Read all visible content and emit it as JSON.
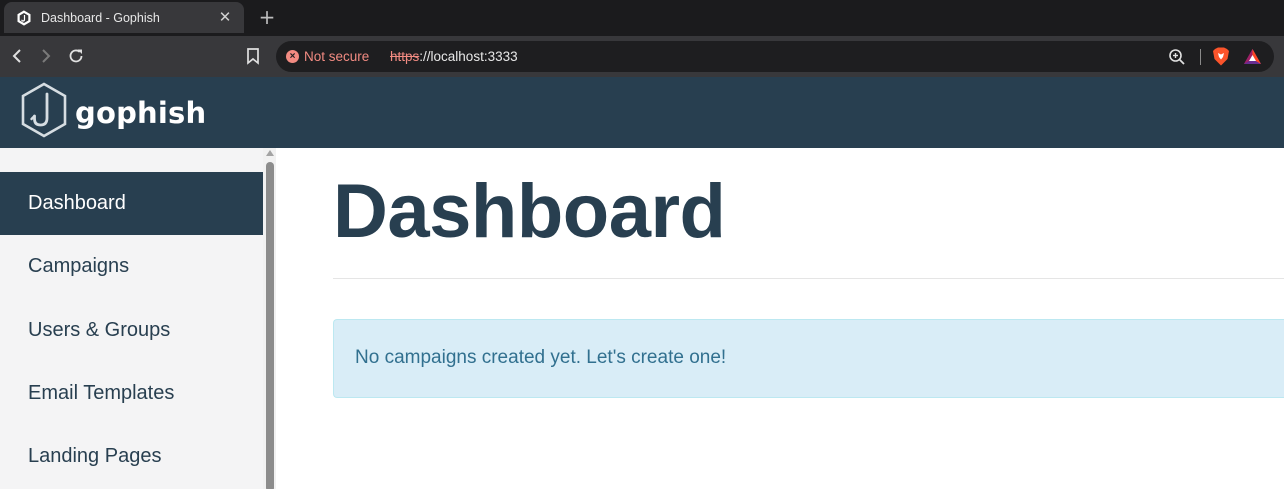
{
  "browser": {
    "tab": {
      "title": "Dashboard - Gophish",
      "close_label": "✕"
    },
    "new_tab_label": "+",
    "omnibox": {
      "security_label": "Not secure",
      "url_scheme": "https",
      "url_rest": "://localhost:3333"
    }
  },
  "app": {
    "brand": "gophish"
  },
  "sidebar": {
    "items": [
      {
        "label": "Dashboard",
        "active": true
      },
      {
        "label": "Campaigns",
        "active": false
      },
      {
        "label": "Users & Groups",
        "active": false
      },
      {
        "label": "Email Templates",
        "active": false
      },
      {
        "label": "Landing Pages",
        "active": false
      }
    ]
  },
  "main": {
    "title": "Dashboard",
    "alert_text": "No campaigns created yet. Let's create one!"
  },
  "colors": {
    "navbar": "#283f50",
    "sidebar_bg": "#f4f4f5",
    "alert_bg": "#d9edf7",
    "alert_text": "#31708f",
    "not_secure": "#f28b82"
  },
  "icons": [
    "gophish-favicon-icon",
    "back-icon",
    "forward-icon",
    "reload-icon",
    "bookmark-icon",
    "not-secure-icon",
    "zoom-icon",
    "brave-shields-icon",
    "brave-rewards-icon",
    "gophish-logo-icon"
  ]
}
